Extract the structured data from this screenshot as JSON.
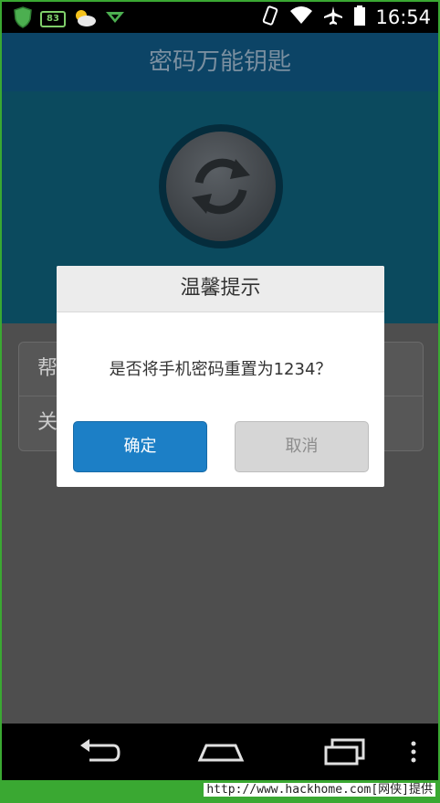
{
  "status_bar": {
    "battery_badge": "83",
    "time": "16:54",
    "icons_left": [
      "shield-icon",
      "battery-badge",
      "weather-icon",
      "signal-down-icon"
    ],
    "icons_right": [
      "vibrate-icon",
      "wifi-icon",
      "airplane-icon",
      "battery-icon"
    ]
  },
  "app": {
    "title": "密码万能钥匙",
    "menu_items": [
      "帮",
      "关"
    ]
  },
  "dialog": {
    "title": "温馨提示",
    "message": "是否将手机密码重置为1234？",
    "confirm_label": "确定",
    "cancel_label": "取消"
  },
  "navbar": {
    "icons": [
      "back-icon",
      "home-icon",
      "recent-apps-icon",
      "overflow-menu-icon"
    ]
  },
  "watermark": {
    "text": "http://www.hackhome.com[网侠]提供"
  },
  "colors": {
    "accent": "#1c7fc6",
    "app_bar": "#0c4466",
    "frame": "#3aa832"
  }
}
